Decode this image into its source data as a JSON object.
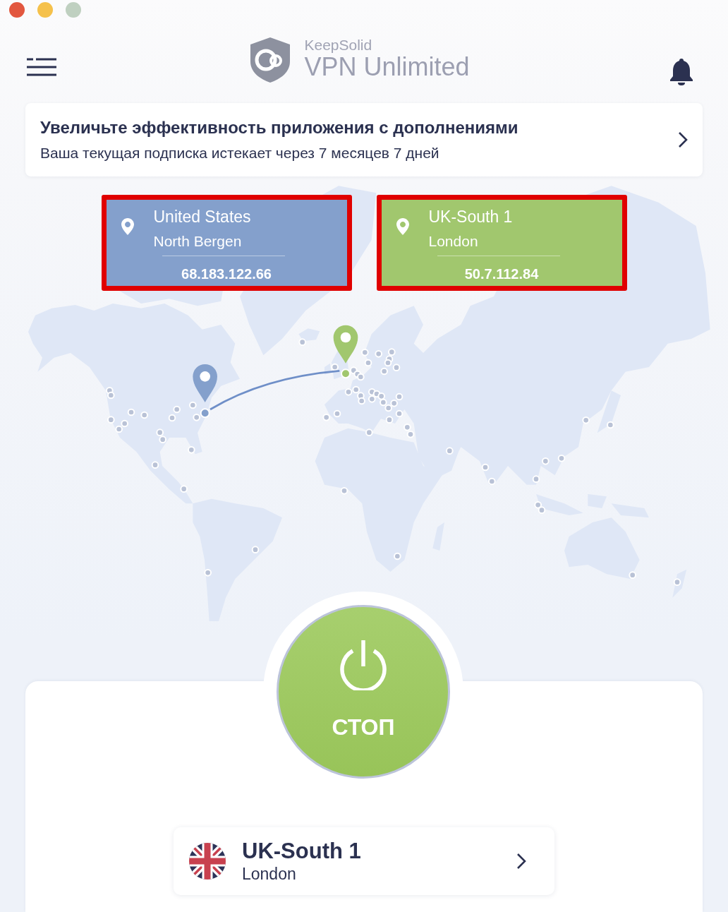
{
  "window": {
    "controls": [
      {
        "kind": "close",
        "disabled": false
      },
      {
        "kind": "minimize",
        "disabled": false
      },
      {
        "kind": "zoom",
        "disabled": true
      }
    ]
  },
  "header": {
    "brand_line_1": "KeepSolid",
    "brand_line_2": "VPN Unlimited"
  },
  "banner": {
    "title": "Увеличьте эффективность приложения с дополнениями",
    "subtitle": "Ваша текущая подписка истекает через 7 месяцев 7 дней"
  },
  "locations": [
    {
      "title": "United States",
      "subtitle": "North Bergen",
      "ip": "68.183.122.66",
      "color": "#84a0cc",
      "highlighted": true
    },
    {
      "title": "UK-South 1",
      "subtitle": "London",
      "ip": "50.7.112.84",
      "color": "#a1c76e",
      "highlighted": true
    }
  ],
  "power_button": {
    "label": "СТОП",
    "connected": true
  },
  "server": {
    "name": "UK-South 1",
    "city": "London"
  }
}
